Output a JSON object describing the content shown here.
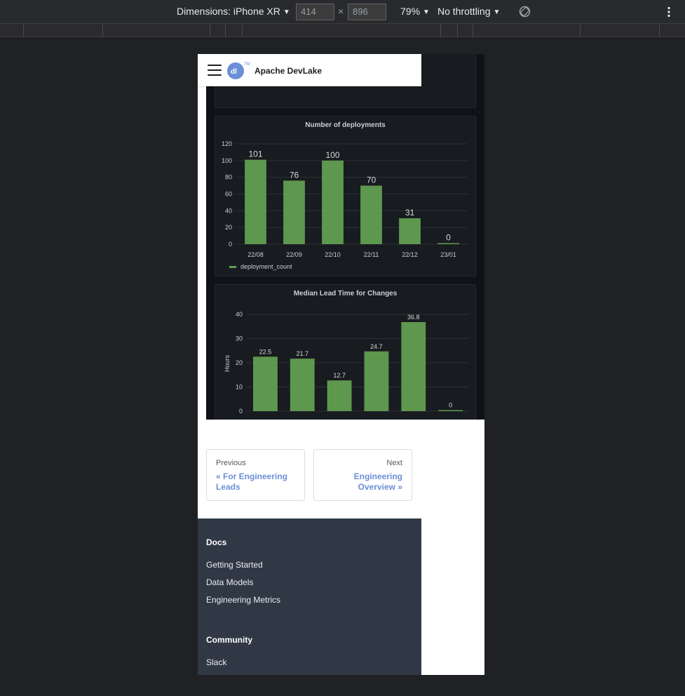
{
  "devtools": {
    "dimensions_label": "Dimensions: iPhone XR",
    "width": "414",
    "times": "×",
    "height": "896",
    "zoom": "79%",
    "throttling": "No throttling"
  },
  "nav": {
    "brand": "Apache DevLake",
    "logo_tm": "TM"
  },
  "deployments_chart": {
    "title": "Number of deployments",
    "legend": "deployment_count",
    "color": "#629e51"
  },
  "lead_time_chart": {
    "title": "Median Lead Time for Changes",
    "ylabel": "Hours",
    "color": "#629e51"
  },
  "chart_data": [
    {
      "type": "bar",
      "title": "Number of deployments",
      "categories": [
        "22/08",
        "22/09",
        "22/10",
        "22/11",
        "22/12",
        "23/01"
      ],
      "series": [
        {
          "name": "deployment_count",
          "values": [
            101,
            76,
            100,
            70,
            31,
            0
          ]
        }
      ],
      "yticks": [
        0,
        20,
        40,
        60,
        80,
        100,
        120
      ],
      "ylim": [
        0,
        120
      ],
      "legend": "bottom-left",
      "grid": true
    },
    {
      "type": "bar",
      "title": "Median Lead Time for Changes",
      "ylabel": "Hours",
      "values": [
        22.5,
        21.7,
        12.7,
        24.7,
        36.8,
        0
      ],
      "yticks": [
        0,
        10,
        20,
        30,
        40
      ],
      "ylim": [
        0,
        40
      ],
      "grid": true
    }
  ],
  "pager": {
    "prev_label": "Previous",
    "prev_link": "« For Engineering Leads",
    "next_label": "Next",
    "next_link": "Engineering Overview »"
  },
  "footer": {
    "docs_title": "Docs",
    "docs_links": [
      "Getting Started",
      "Data Models",
      "Engineering Metrics"
    ],
    "community_title": "Community",
    "community_links": [
      "Slack"
    ]
  }
}
